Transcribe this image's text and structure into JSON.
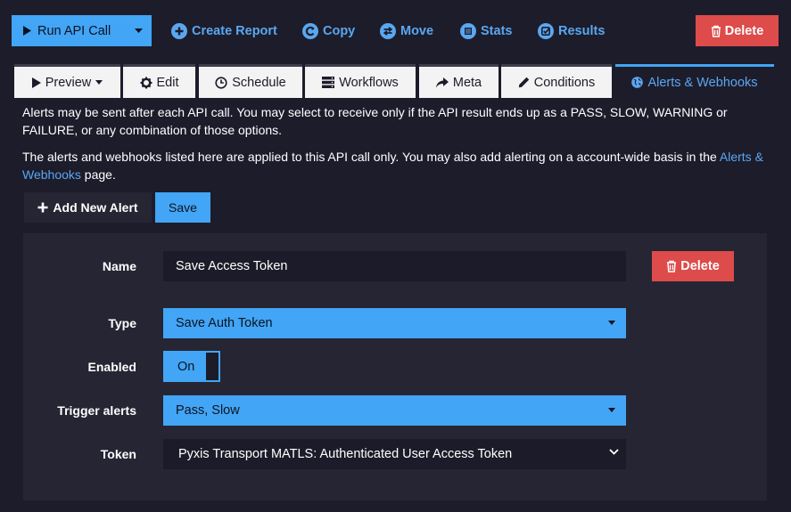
{
  "toolbar": {
    "run_label": "Run API Call",
    "create_report": "Create Report",
    "copy": "Copy",
    "move": "Move",
    "stats": "Stats",
    "results": "Results",
    "delete": "Delete"
  },
  "tabs": [
    {
      "label": "Preview",
      "icon": "play-icon"
    },
    {
      "label": "Edit",
      "icon": "gear-icon"
    },
    {
      "label": "Schedule",
      "icon": "clock-icon"
    },
    {
      "label": "Workflows",
      "icon": "server-icon"
    },
    {
      "label": "Meta",
      "icon": "share-arrow-icon"
    },
    {
      "label": "Conditions",
      "icon": "pencil-icon"
    },
    {
      "label": "Alerts & Webhooks",
      "icon": "globe-icon",
      "active": true
    }
  ],
  "description": {
    "para1": "Alerts may be sent after each API call. You may select to receive only if the API result ends up as a PASS, SLOW, WARNING or FAILURE, or any combination of those options.",
    "para2_prefix": "The alerts and webhooks listed here are applied to this API call only. You may also add alerting on a account-wide basis in the ",
    "para2_link": "Alerts & Webhooks",
    "para2_suffix": " page."
  },
  "actions": {
    "add_new_alert": "Add New Alert",
    "save": "Save"
  },
  "form": {
    "name_label": "Name",
    "name_value": "Save Access Token",
    "delete": "Delete",
    "type_label": "Type",
    "type_value": "Save Auth Token",
    "enabled_label": "Enabled",
    "enabled_value": "On",
    "trigger_label": "Trigger alerts",
    "trigger_value": "Pass, Slow",
    "token_label": "Token",
    "token_value": "Pyxis Transport MATLS: Authenticated User Access Token"
  },
  "colors": {
    "accent": "#42a5f5",
    "danger": "#dd4b4b",
    "background": "#1d1c2b",
    "panel": "#262534",
    "link": "#5aa7f0"
  }
}
